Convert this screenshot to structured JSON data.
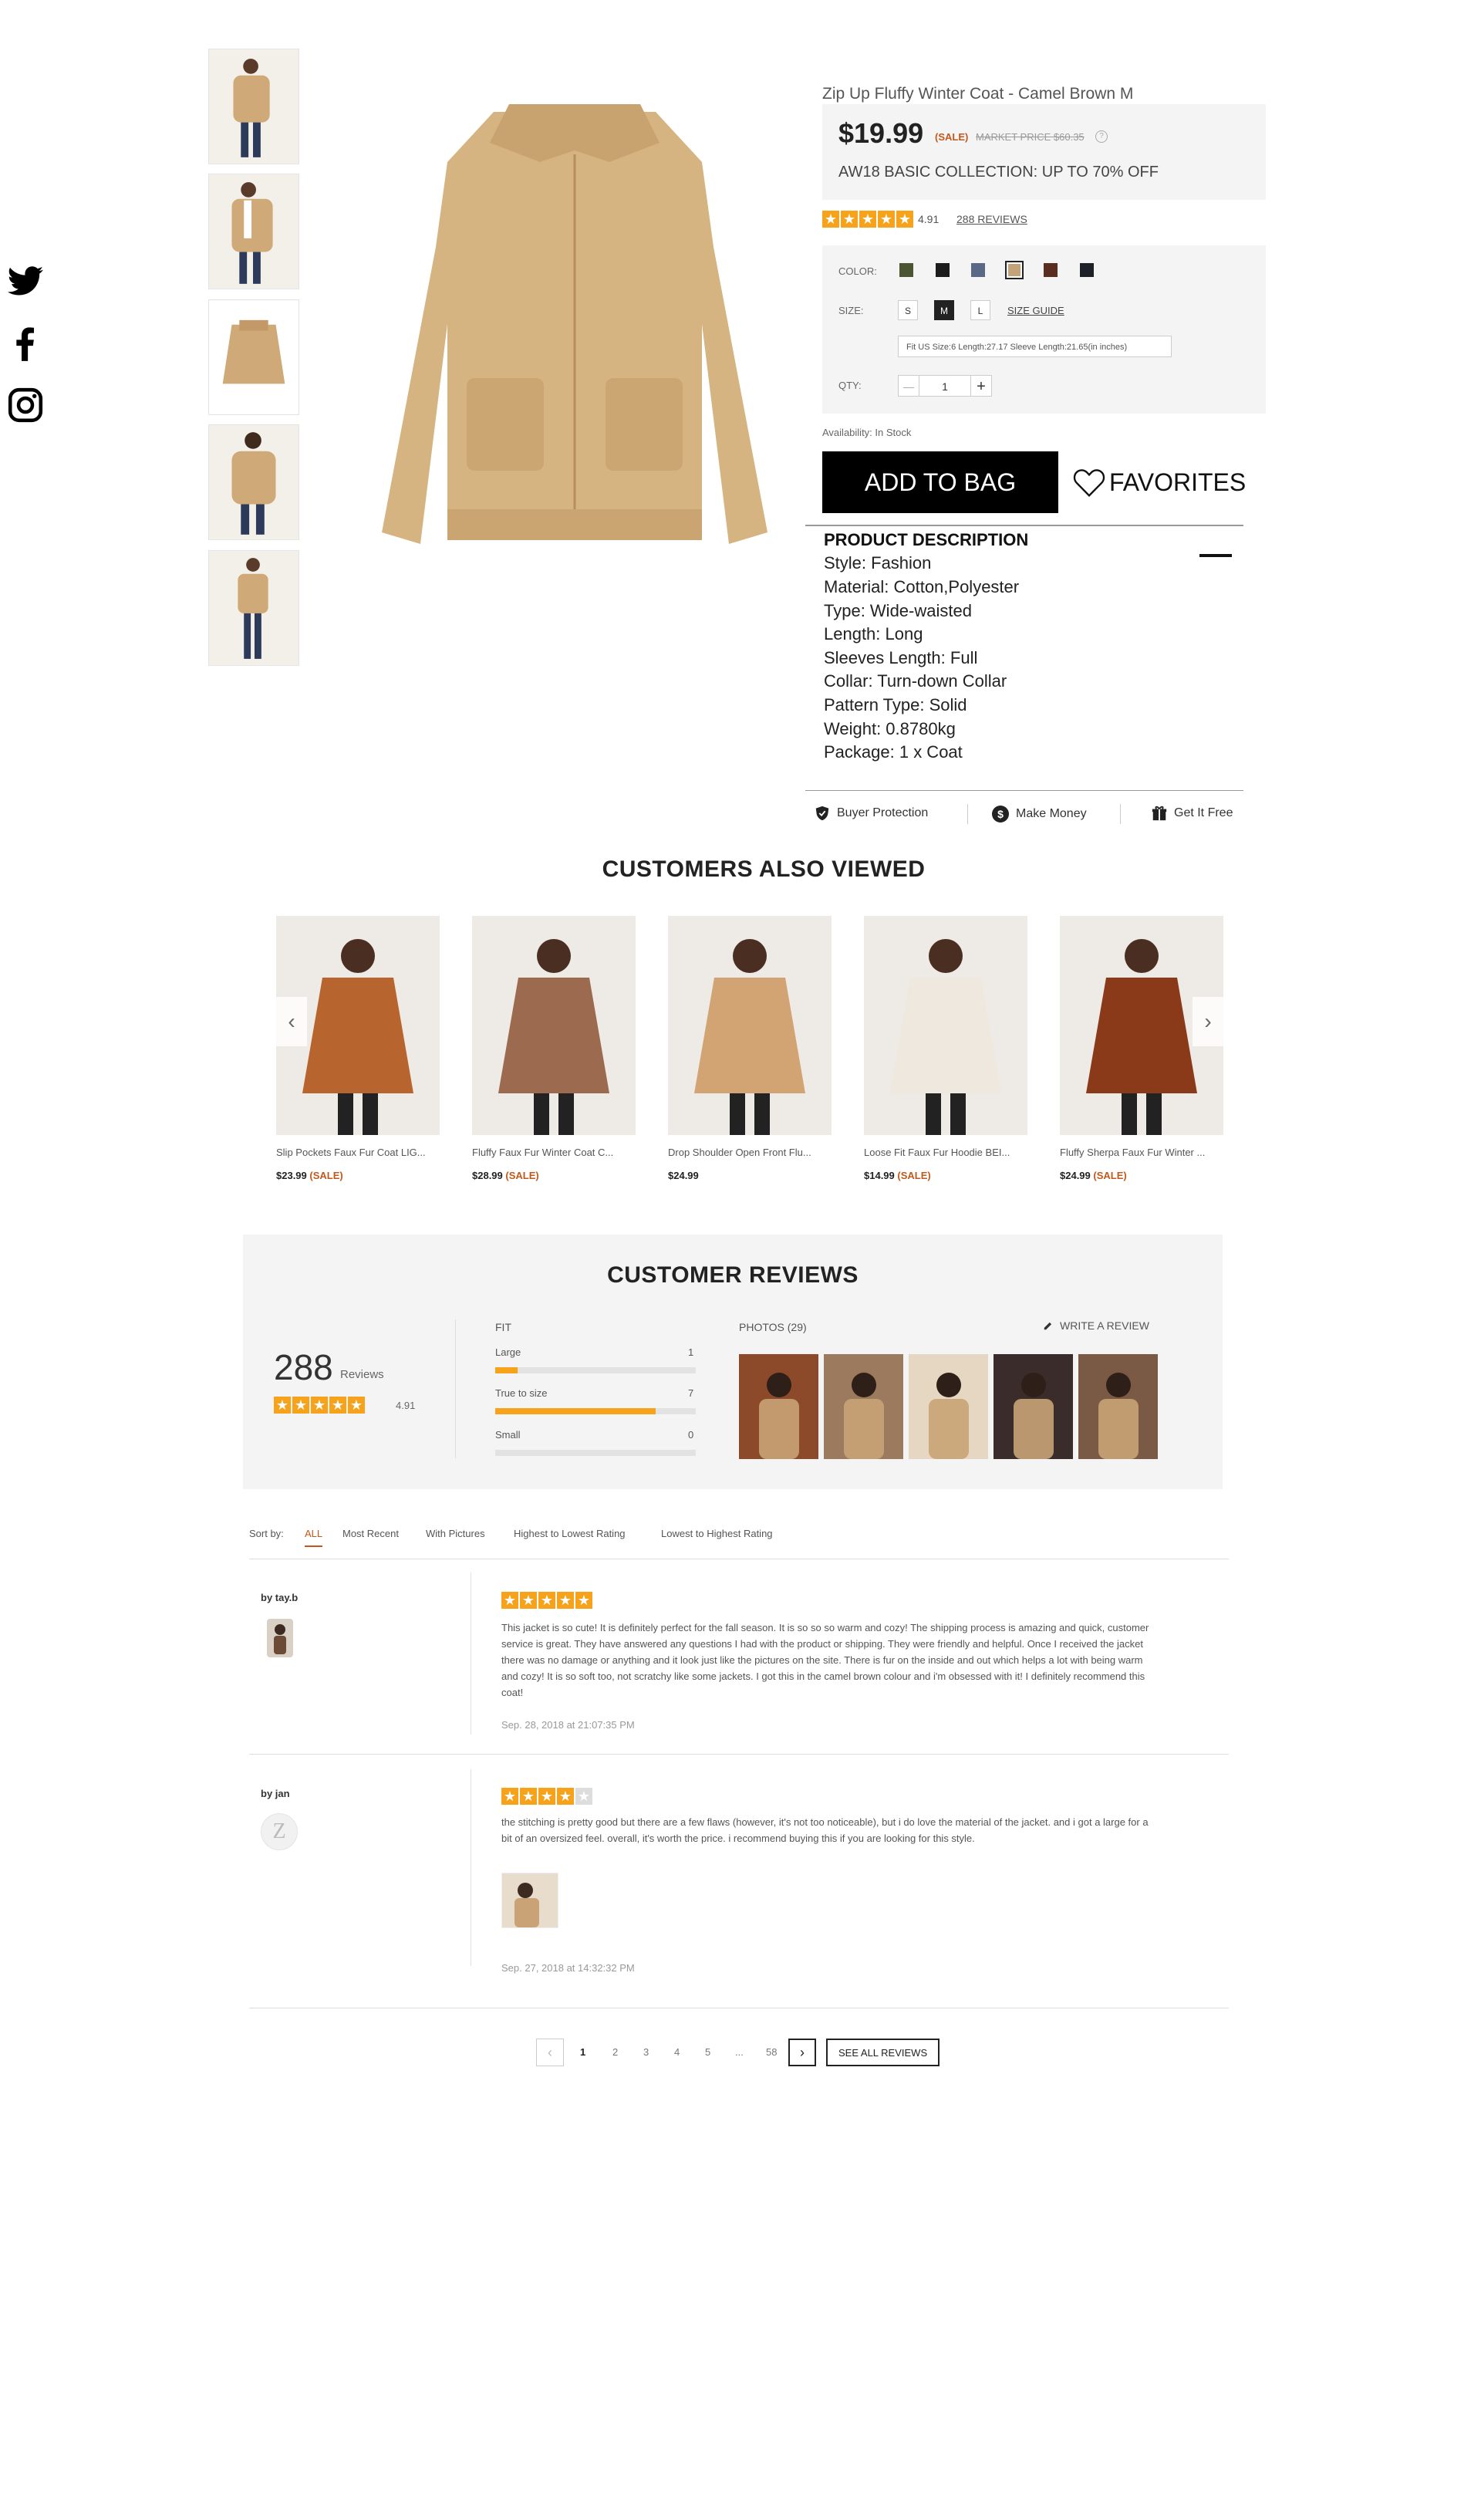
{
  "social": [
    "twitter-icon",
    "facebook-icon",
    "instagram-icon"
  ],
  "product": {
    "title": "Zip Up Fluffy Winter Coat - Camel Brown M",
    "price": "$19.99",
    "sale": "(SALE)",
    "market_price": "MARKET PRICE $60.35",
    "promo": "AW18 BASIC COLLECTION: UP TO 70% OFF",
    "rating": "4.91",
    "rating_stars": 5,
    "reviews_link": "288 REVIEWS",
    "color_label": "COLOR:",
    "colors": [
      "#4b5532",
      "#1c1c1c",
      "#5a6888",
      "#c4a27a",
      "#5a2e1f",
      "#1e2228"
    ],
    "selected_color": 3,
    "size_label": "SIZE:",
    "sizes": [
      "S",
      "M",
      "L"
    ],
    "selected_size": "M",
    "size_guide": "SIZE GUIDE",
    "fit_info": "Fit US Size:6    Length:27.17    Sleeve Length:21.65(in inches)",
    "qty_label": "QTY:",
    "qty": "1",
    "qty_minus": "—",
    "qty_plus": "+",
    "availability": "Availability: In Stock",
    "add_to_bag": "ADD TO BAG",
    "favorites": "FAVORITES",
    "description_title": "PRODUCT DESCRIPTION",
    "description": [
      "Style: Fashion",
      "Material: Cotton,Polyester",
      "Type: Wide-waisted",
      "Length: Long",
      "Sleeves Length: Full",
      "Collar: Turn-down Collar",
      "Pattern Type: Solid",
      "Weight: 0.8780kg",
      "Package: 1 x Coat"
    ],
    "services": [
      "Buyer Protection",
      "Make Money",
      "Get It Free"
    ]
  },
  "also_viewed": {
    "title": "CUSTOMERS ALSO VIEWED",
    "items": [
      {
        "name": "Slip Pockets Faux Fur Coat LIG...",
        "price": "$23.99",
        "sale": "(SALE)",
        "color": "#b8642e"
      },
      {
        "name": "Fluffy Faux Fur Winter Coat C...",
        "price": "$28.99",
        "sale": "(SALE)",
        "color": "#9c6a4e"
      },
      {
        "name": "Drop Shoulder Open Front Flu...",
        "price": "$24.99",
        "sale": "",
        "color": "#d2a474"
      },
      {
        "name": "Loose Fit Faux Fur Hoodie BEI...",
        "price": "$14.99",
        "sale": "(SALE)",
        "color": "#efe8df"
      },
      {
        "name": "Fluffy Sherpa Faux Fur Winter ...",
        "price": "$24.99",
        "sale": "(SALE)",
        "color": "#8a3a18"
      }
    ],
    "prev": "‹",
    "next": "›"
  },
  "reviews": {
    "title": "CUSTOMER REVIEWS",
    "count": "288",
    "count_label": "Reviews",
    "rating": "4.91",
    "fit_title": "FIT",
    "fit": [
      {
        "label": "Large",
        "count": "1",
        "fraction": 0.11
      },
      {
        "label": "True to size",
        "count": "7",
        "fraction": 0.8
      },
      {
        "label": "Small",
        "count": "0",
        "fraction": 0
      }
    ],
    "photos_title": "PHOTOS (29)",
    "write_review": "WRITE A REVIEW",
    "sort_label": "Sort by:",
    "sort_options": [
      "ALL",
      "Most Recent",
      "With Pictures",
      "Highest to Lowest Rating",
      "Lowest to Highest Rating"
    ],
    "items": [
      {
        "author": "by tay.b",
        "stars": 5,
        "text": "This jacket is so cute! It is definitely perfect for the fall season. It is so so so warm and cozy! The shipping process is amazing and quick, customer service is great. They have answered any questions I had with the product or shipping. They were friendly and helpful. Once I received the jacket there was no damage or anything and it look just like the pictures on the site. There is fur on the inside and out which helps a lot with being warm and cozy! It is so soft too, not scratchy like some jackets. I got this in the camel brown colour and i'm obsessed with it! I definitely recommend this coat!",
        "date": "Sep. 28, 2018 at 21:07:35 PM"
      },
      {
        "author": "by jan",
        "avatar_letter": "Z",
        "stars": 4,
        "text": "the stitching is pretty good but there are a few flaws (however, it's not too noticeable), but i do love the material of the jacket. and i got a large for a bit of an oversized feel. overall, it's worth the price. i recommend buying this if you are looking for this style.",
        "date": "Sep. 27, 2018 at 14:32:32 PM"
      }
    ],
    "pages": [
      "1",
      "2",
      "3",
      "4",
      "5",
      "...",
      "58"
    ],
    "current_page": "1",
    "see_all": "SEE ALL REVIEWS"
  }
}
